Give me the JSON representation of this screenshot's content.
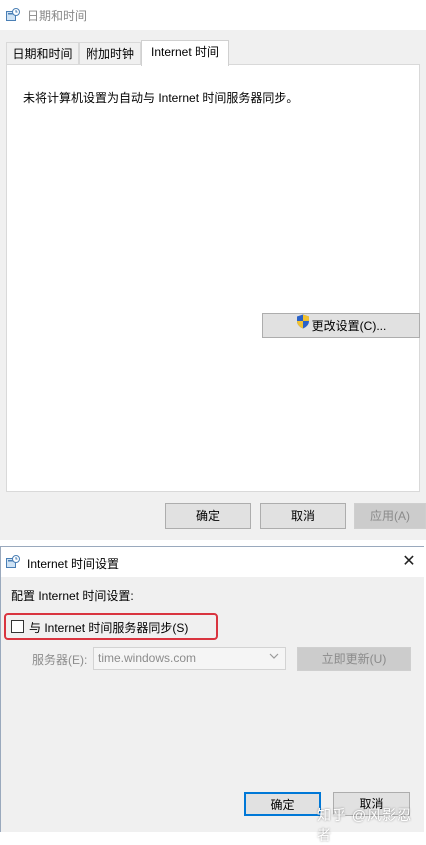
{
  "dialog1": {
    "title": "日期和时间",
    "tabs": [
      {
        "label": "日期和时间"
      },
      {
        "label": "附加时钟"
      },
      {
        "label": "Internet 时间"
      }
    ],
    "status_text": "未将计算机设置为自动与 Internet 时间服务器同步。",
    "change_settings_label": "更改设置(C)...",
    "ok_label": "确定",
    "cancel_label": "取消",
    "apply_label": "应用(A)"
  },
  "dialog2": {
    "title": "Internet 时间设置",
    "close_glyph": "✕",
    "config_label": "配置 Internet 时间设置:",
    "sync_checkbox": {
      "label": "与 Internet 时间服务器同步(S)",
      "checked": false
    },
    "server_label": "服务器(E):",
    "server_value": "time.windows.com",
    "update_now_label": "立即更新(U)",
    "ok_label": "确定",
    "cancel_label": "取消"
  },
  "watermark": "知乎 @风影忍者",
  "colors": {
    "highlight_border": "#d9343f",
    "default_button_border": "#0078d7",
    "dialog_bg": "#f0f0f0"
  },
  "icons": {
    "window_icon": "clock-window-icon",
    "uac": "uac-shield-icon",
    "close": "close-icon",
    "dropdown": "chevron-down-icon"
  }
}
